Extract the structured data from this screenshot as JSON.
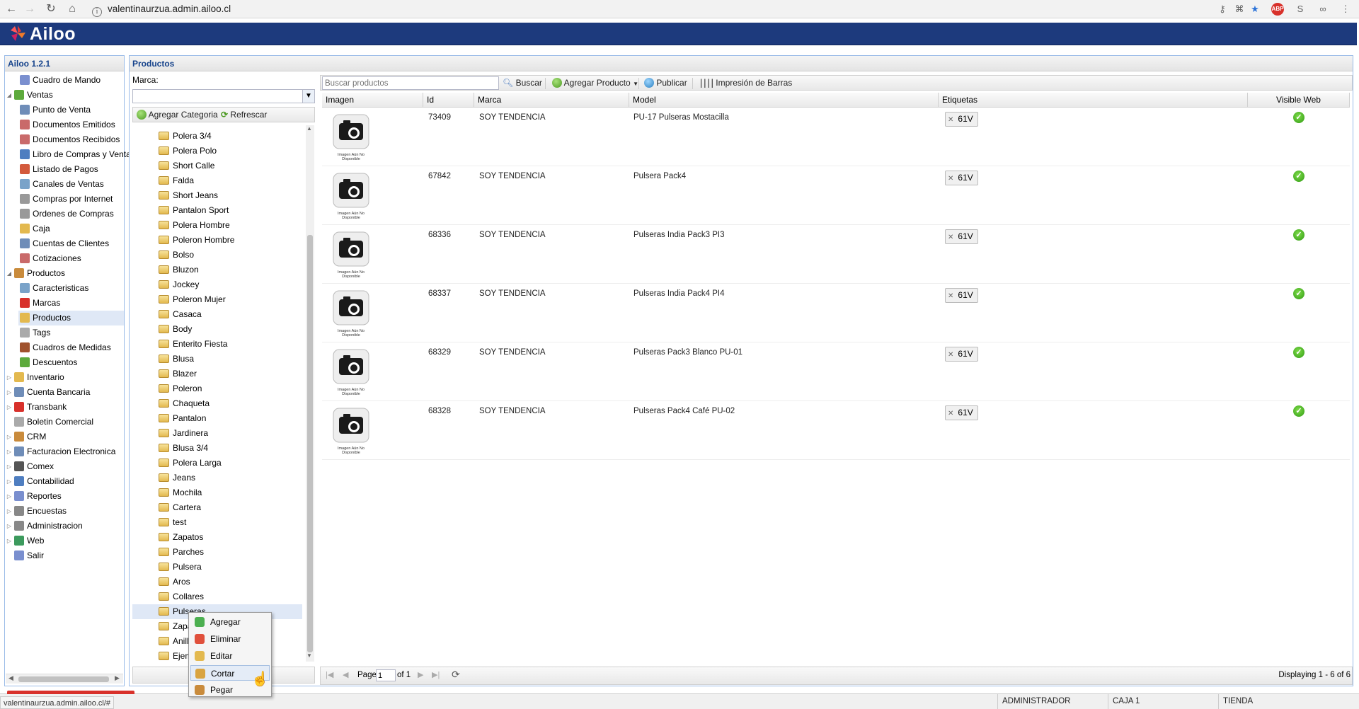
{
  "browser": {
    "url": "valentinaurzua.admin.ailoo.cl",
    "status_url": "valentinaurzua.admin.ailoo.cl/#"
  },
  "app": {
    "name": "Ailoo",
    "version": "Ailoo 1.2.1"
  },
  "nav": [
    {
      "label": "Cuadro de Mando",
      "level": 1,
      "icon": "chart-icon",
      "color": "#7a8fcf"
    },
    {
      "label": "Ventas",
      "level": 0,
      "toggle": "◢",
      "icon": "tag-icon",
      "color": "#5daa3c"
    },
    {
      "label": "Punto de Venta",
      "level": 1,
      "icon": "monitor-icon",
      "color": "#6f8db8"
    },
    {
      "label": "Documentos Emitidos",
      "level": 1,
      "icon": "document-icon",
      "color": "#c96a6a"
    },
    {
      "label": "Documentos Recibidos",
      "level": 1,
      "icon": "document-icon",
      "color": "#c96a6a"
    },
    {
      "label": "Libro de Compras y Ventas",
      "level": 1,
      "icon": "book-icon",
      "color": "#4f7ec0"
    },
    {
      "label": "Listado de Pagos",
      "level": 1,
      "icon": "payment-icon",
      "color": "#d35a3c"
    },
    {
      "label": "Canales de Ventas",
      "level": 1,
      "icon": "channel-icon",
      "color": "#7aa3c9"
    },
    {
      "label": "Compras por Internet",
      "level": 1,
      "icon": "cart-icon",
      "color": "#999999"
    },
    {
      "label": "Ordenes de Compras",
      "level": 1,
      "icon": "cart-icon",
      "color": "#999999"
    },
    {
      "label": "Caja",
      "level": 1,
      "icon": "cash-icon",
      "color": "#e3b94f"
    },
    {
      "label": "Cuentas de Clientes",
      "level": 1,
      "icon": "accounts-icon",
      "color": "#6f8db8"
    },
    {
      "label": "Cotizaciones",
      "level": 1,
      "icon": "quote-icon",
      "color": "#c96a6a"
    },
    {
      "label": "Productos",
      "level": 0,
      "toggle": "◢",
      "icon": "box-icon",
      "color": "#c98b3c"
    },
    {
      "label": "Caracteristicas",
      "level": 1,
      "icon": "features-icon",
      "color": "#7aa3c9"
    },
    {
      "label": "Marcas",
      "level": 1,
      "icon": "ribbon-icon",
      "color": "#d8312b"
    },
    {
      "label": "Productos",
      "level": 1,
      "icon": "package-icon",
      "color": "#e3b94f",
      "selected": true
    },
    {
      "label": "Tags",
      "level": 1,
      "icon": "tags-icon",
      "color": "#aaaaaa"
    },
    {
      "label": "Cuadros de Medidas",
      "level": 1,
      "icon": "ruler-icon",
      "color": "#a0522d"
    },
    {
      "label": "Descuentos",
      "level": 1,
      "icon": "discount-icon",
      "color": "#5daa3c"
    },
    {
      "label": "Inventario",
      "level": 0,
      "toggle": "▷",
      "icon": "inventory-icon",
      "color": "#e3b94f"
    },
    {
      "label": "Cuenta Bancaria",
      "level": 0,
      "toggle": "▷",
      "icon": "bank-icon",
      "color": "#6f8db8"
    },
    {
      "label": "Transbank",
      "level": 0,
      "toggle": "▷",
      "icon": "transbank-icon",
      "color": "#d8312b"
    },
    {
      "label": "Boletin Comercial",
      "level": 0,
      "toggle": "",
      "icon": "bulletin-icon",
      "color": "#aaaaaa"
    },
    {
      "label": "CRM",
      "level": 0,
      "toggle": "▷",
      "icon": "crm-icon",
      "color": "#c98b3c"
    },
    {
      "label": "Facturacion Electronica",
      "level": 0,
      "toggle": "▷",
      "icon": "invoice-icon",
      "color": "#6f8db8"
    },
    {
      "label": "Comex",
      "level": 0,
      "toggle": "▷",
      "icon": "comex-icon",
      "color": "#555555"
    },
    {
      "label": "Contabilidad",
      "level": 0,
      "toggle": "▷",
      "icon": "accounting-icon",
      "color": "#4f7ec0"
    },
    {
      "label": "Reportes",
      "level": 0,
      "toggle": "▷",
      "icon": "reports-icon",
      "color": "#7a8fcf"
    },
    {
      "label": "Encuestas",
      "level": 0,
      "toggle": "▷",
      "icon": "survey-icon",
      "color": "#888888"
    },
    {
      "label": "Administracion",
      "level": 0,
      "toggle": "▷",
      "icon": "gear-icon",
      "color": "#888888"
    },
    {
      "label": "Web",
      "level": 0,
      "toggle": "▷",
      "icon": "globe-icon",
      "color": "#3c9a5d"
    },
    {
      "label": "Salir",
      "level": 0,
      "toggle": "",
      "icon": "exit-icon",
      "color": "#7a8fcf"
    }
  ],
  "categories_panel": {
    "title": "Productos",
    "brand_label": "Marca:",
    "brand_value": "",
    "add_category": "Agregar Categoria",
    "refresh": "Refrescar",
    "categories": [
      "Polera 3/4",
      "Polera Polo",
      "Short Calle",
      "Falda",
      "Short Jeans",
      "Pantalon Sport",
      "Polera Hombre",
      "Poleron Hombre",
      "Bolso",
      "Bluzon",
      "Jockey",
      "Poleron Mujer",
      "Casaca",
      "Body",
      "Enterito Fiesta",
      "Blusa",
      "Blazer",
      "Poleron",
      "Chaqueta",
      "Pantalon",
      "Jardinera",
      "Blusa 3/4",
      "Polera Larga",
      "Jeans",
      "Mochila",
      "Cartera",
      "test",
      "Zapatos",
      "Parches",
      "Pulsera",
      "Aros",
      "Collares",
      "Pulseras",
      "Zapatillas",
      "Anillos",
      "Ejemplo"
    ]
  },
  "toolbar": {
    "search_placeholder": "Buscar productos",
    "search": "Buscar",
    "add_product": "Agregar Producto",
    "publish": "Publicar",
    "barcode": "Impresión de Barras"
  },
  "grid": {
    "columns": [
      "Imagen",
      "Id",
      "Marca",
      "Model",
      "Etiquetas",
      "Visible Web"
    ],
    "image_caption": "Imagen Aún No Disponible",
    "rows": [
      {
        "id": "73409",
        "brand": "SOY TENDENCIA",
        "model": "PU-17 Pulseras Mostacilla",
        "tag": "61V",
        "visible": true
      },
      {
        "id": "67842",
        "brand": "SOY TENDENCIA",
        "model": "Pulsera Pack4",
        "tag": "61V",
        "visible": true
      },
      {
        "id": "68336",
        "brand": "SOY TENDENCIA",
        "model": "Pulseras India Pack3 PI3",
        "tag": "61V",
        "visible": true
      },
      {
        "id": "68337",
        "brand": "SOY TENDENCIA",
        "model": "Pulseras India Pack4 PI4",
        "tag": "61V",
        "visible": true
      },
      {
        "id": "68329",
        "brand": "SOY TENDENCIA",
        "model": "Pulseras Pack3 Blanco PU-01",
        "tag": "61V",
        "visible": true
      },
      {
        "id": "68328",
        "brand": "SOY TENDENCIA",
        "model": "Pulseras Pack4 Café PU-02",
        "tag": "61V",
        "visible": true
      }
    ]
  },
  "paging": {
    "page_label": "Page",
    "page": "1",
    "of": "of 1",
    "displaying": "Displaying 1 - 6 of 6"
  },
  "context_menu": [
    {
      "label": "Agregar",
      "icon": "add-icon",
      "color": "#4caf50"
    },
    {
      "label": "Eliminar",
      "icon": "delete-icon",
      "color": "#e0503c"
    },
    {
      "label": "Editar",
      "icon": "edit-icon",
      "color": "#e3b94f"
    },
    {
      "label": "Cortar",
      "icon": "cut-icon",
      "color": "#d9a441",
      "active": true
    },
    {
      "label": "Pegar",
      "icon": "paste-icon",
      "color": "#c98b3c"
    }
  ],
  "status": {
    "user": "ADMINISTRADOR",
    "box": "CAJA 1",
    "store": "TIENDA"
  }
}
